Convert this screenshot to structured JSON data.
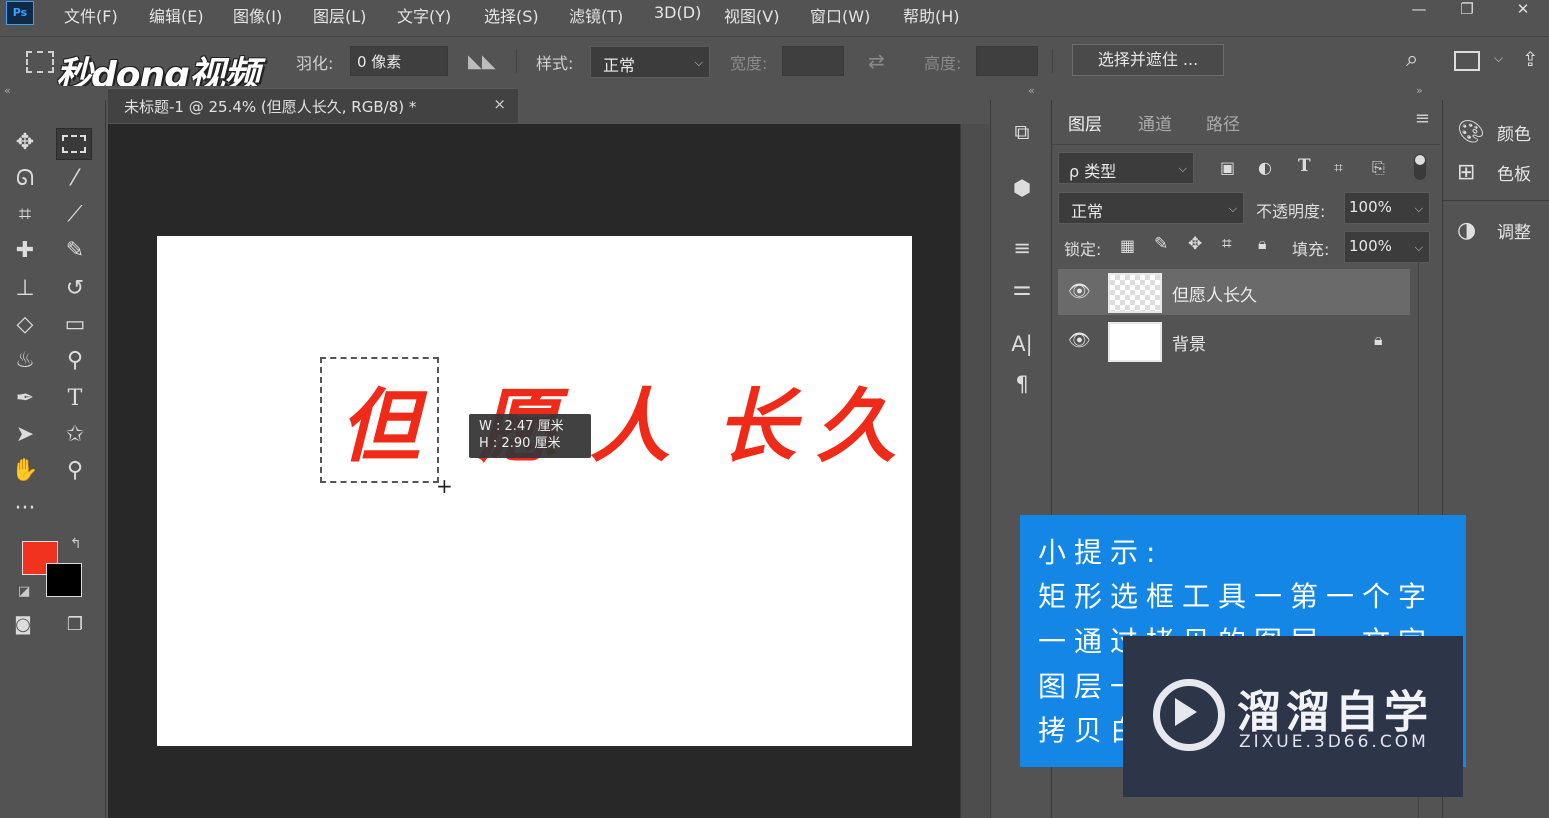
{
  "app": {
    "logo_text": "Ps"
  },
  "menu": [
    "文件(F)",
    "编辑(E)",
    "图像(I)",
    "图层(L)",
    "文字(Y)",
    "选择(S)",
    "滤镜(T)",
    "3D(D)",
    "视图(V)",
    "窗口(W)",
    "帮助(H)"
  ],
  "window_controls": {
    "minimize": "—",
    "restore": "❐",
    "close": "✕"
  },
  "options_bar": {
    "feather_label": "羽化:",
    "feather_value": "0 像素",
    "style_label": "样式:",
    "style_value": "正常",
    "width_label": "宽度:",
    "height_label": "高度:",
    "select_mask_button": "选择并遮住 ..."
  },
  "watermark_top": "秒dong视频",
  "document_tab": {
    "title": "未标题-1 @ 25.4% (但愿人长久, RGB/8) *",
    "close": "×"
  },
  "canvas": {
    "text_chars": [
      "但",
      "愿",
      "人",
      "长",
      "久"
    ],
    "text_color": "#ef2a18",
    "size_tooltip": {
      "w": "W : 2.47 厘米",
      "h": "H : 2.90 厘米"
    }
  },
  "colors": {
    "foreground": "#f0321f",
    "background": "#000000",
    "tip_bg": "#1386e6"
  },
  "layers_panel": {
    "tabs": [
      "图层",
      "通道",
      "路径"
    ],
    "filter_label": "ρ 类型",
    "blend_mode": "正常",
    "opacity_label": "不透明度:",
    "opacity_value": "100%",
    "lock_label": "锁定:",
    "fill_label": "填充:",
    "fill_value": "100%",
    "layers": [
      {
        "name": "但愿人长久",
        "selected": true,
        "locked": false
      },
      {
        "name": "背景",
        "selected": false,
        "locked": true
      }
    ]
  },
  "right_panel": [
    {
      "icon": "palette-icon",
      "label": "颜色"
    },
    {
      "icon": "grid-icon",
      "label": "色板"
    },
    {
      "icon": "adjust-icon",
      "label": "调整"
    }
  ],
  "tip": {
    "lines": [
      "小提示:",
      "矩形选框工具一第一个字",
      "一通过拷贝的图层一文字",
      "图层一",
      "拷贝白"
    ]
  },
  "logo_overlay": {
    "main": "溜溜自学",
    "sub": "ZIXUE.3D66.COM"
  }
}
